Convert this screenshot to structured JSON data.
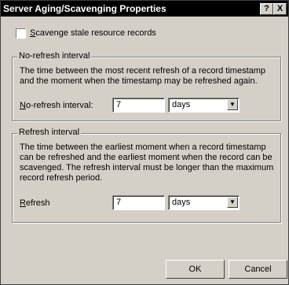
{
  "window": {
    "title": "Server Aging/Scavenging Properties",
    "help_button": "?",
    "close_button": "X"
  },
  "scavenge": {
    "checked": false,
    "label_accel": "S",
    "label_rest": "cavenge stale resource records"
  },
  "no_refresh": {
    "legend": "No-refresh interval",
    "description": "The time between the most recent refresh of a record timestamp and the moment when the timestamp may be refreshed again.",
    "field_label_accel": "N",
    "field_label_rest": "o-refresh interval:",
    "value": "7",
    "unit": "days"
  },
  "refresh": {
    "legend": "Refresh interval",
    "description": "The time between the earliest moment when a record timestamp can be refreshed and the earliest moment when the record can be scavenged. The refresh interval must be longer than the maximum record refresh period.",
    "field_label_accel": "R",
    "field_label_rest": "efresh",
    "value": "7",
    "unit": "days"
  },
  "buttons": {
    "ok": "OK",
    "cancel": "Cancel"
  },
  "icons": {
    "dropdown": "chevron-down-icon"
  }
}
